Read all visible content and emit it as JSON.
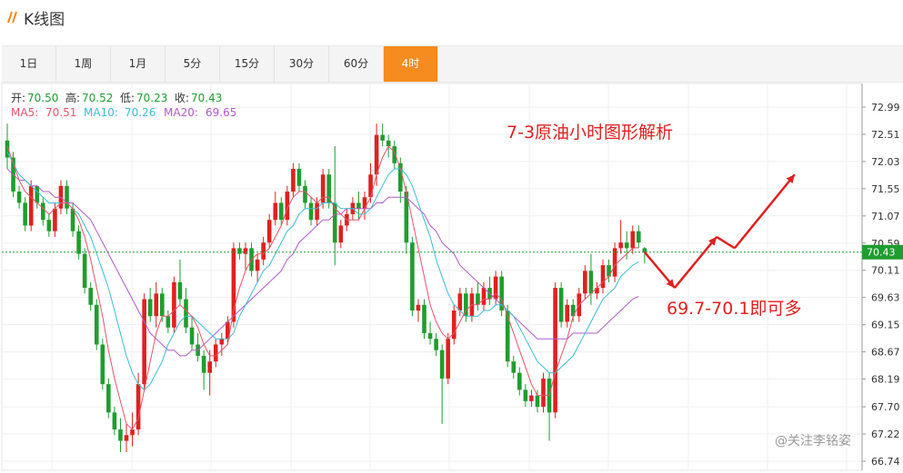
{
  "app": {
    "title": "K线图"
  },
  "tabs": [
    {
      "label": "1日",
      "active": false
    },
    {
      "label": "1周",
      "active": false
    },
    {
      "label": "1月",
      "active": false
    },
    {
      "label": "5分",
      "active": false
    },
    {
      "label": "15分",
      "active": false
    },
    {
      "label": "30分",
      "active": false
    },
    {
      "label": "60分",
      "active": false
    },
    {
      "label": "4时",
      "active": true
    }
  ],
  "ohlc": {
    "open_label": "开:",
    "open": "70.50",
    "high_label": "高:",
    "high": "70.52",
    "low_label": "低:",
    "low": "70.23",
    "close_label": "收:",
    "close": "70.43"
  },
  "ma": {
    "ma5_label": "MA5:",
    "ma5": "70.51",
    "ma10_label": "MA10:",
    "ma10": "70.26",
    "ma20_label": "MA20:",
    "ma20": "69.65"
  },
  "annotations": {
    "title": "7-3原油小时图形解析",
    "advice": "69.7-70.1即可多",
    "watermark": "@关注李铭姿"
  },
  "colors": {
    "up": "#e02020",
    "down": "#1f9d2f",
    "ma5": "#e8536a",
    "ma10": "#3bbcd4",
    "ma20": "#b05ac8",
    "accent": "#f68b1f",
    "annotation": "#e02020",
    "last_price_bg": "#1f9d2f"
  },
  "chart_data": {
    "type": "candlestick",
    "y_axis_ticks": [
      "72.99",
      "72.51",
      "72.03",
      "71.55",
      "71.07",
      "70.59",
      "70.11",
      "69.63",
      "69.15",
      "68.67",
      "68.19",
      "67.70",
      "67.22",
      "66.74"
    ],
    "ylim": [
      66.74,
      72.99
    ],
    "last_price": "70.43",
    "grid": true,
    "candles": [
      [
        72.4,
        72.7,
        71.9,
        72.1
      ],
      [
        72.1,
        72.2,
        71.4,
        71.5
      ],
      [
        71.5,
        71.6,
        71.2,
        71.3
      ],
      [
        71.3,
        71.4,
        70.8,
        70.9
      ],
      [
        70.9,
        71.7,
        70.8,
        71.6
      ],
      [
        71.6,
        71.6,
        71.2,
        71.3
      ],
      [
        71.3,
        71.4,
        70.9,
        71.0
      ],
      [
        71.0,
        71.1,
        70.7,
        70.8
      ],
      [
        70.8,
        71.3,
        70.7,
        71.2
      ],
      [
        71.2,
        71.7,
        71.1,
        71.6
      ],
      [
        71.6,
        71.7,
        71.1,
        71.2
      ],
      [
        71.2,
        71.3,
        70.7,
        70.8
      ],
      [
        70.8,
        70.9,
        70.3,
        70.4
      ],
      [
        70.4,
        70.5,
        69.7,
        69.8
      ],
      [
        69.8,
        69.9,
        69.4,
        69.5
      ],
      [
        69.5,
        69.6,
        68.7,
        68.8
      ],
      [
        68.8,
        68.9,
        68.0,
        68.1
      ],
      [
        68.1,
        68.2,
        67.5,
        67.6
      ],
      [
        67.6,
        67.7,
        67.2,
        67.3
      ],
      [
        67.3,
        67.5,
        66.9,
        67.1
      ],
      [
        67.1,
        67.4,
        66.9,
        67.2
      ],
      [
        67.2,
        67.6,
        67.0,
        67.3
      ],
      [
        67.3,
        68.3,
        67.2,
        68.1
      ],
      [
        68.1,
        69.7,
        68.0,
        69.6
      ],
      [
        69.6,
        69.8,
        69.2,
        69.3
      ],
      [
        69.3,
        69.9,
        69.1,
        69.7
      ],
      [
        69.7,
        69.8,
        69.2,
        69.3
      ],
      [
        69.3,
        69.4,
        69.0,
        69.1
      ],
      [
        69.1,
        70.0,
        69.0,
        69.9
      ],
      [
        69.9,
        70.3,
        69.5,
        69.6
      ],
      [
        69.6,
        69.8,
        69.0,
        69.1
      ],
      [
        69.1,
        69.3,
        68.7,
        68.8
      ],
      [
        68.8,
        69.0,
        68.5,
        68.6
      ],
      [
        68.6,
        68.7,
        68.0,
        68.3
      ],
      [
        68.3,
        68.7,
        67.9,
        68.5
      ],
      [
        68.5,
        68.9,
        68.4,
        68.8
      ],
      [
        68.8,
        69.0,
        68.6,
        68.9
      ],
      [
        68.9,
        69.3,
        68.8,
        69.2
      ],
      [
        69.2,
        70.6,
        69.1,
        70.5
      ],
      [
        70.5,
        70.6,
        70.3,
        70.4
      ],
      [
        70.4,
        70.6,
        70.1,
        70.5
      ],
      [
        70.5,
        70.6,
        70.0,
        70.1
      ],
      [
        70.1,
        70.4,
        69.9,
        70.3
      ],
      [
        70.3,
        70.7,
        70.2,
        70.6
      ],
      [
        70.6,
        71.1,
        70.5,
        71.0
      ],
      [
        71.0,
        71.5,
        70.9,
        71.3
      ],
      [
        71.3,
        71.4,
        70.9,
        71.0
      ],
      [
        71.0,
        71.6,
        70.9,
        71.5
      ],
      [
        71.5,
        72.0,
        71.4,
        71.9
      ],
      [
        71.9,
        72.0,
        71.5,
        71.6
      ],
      [
        71.6,
        71.7,
        71.2,
        71.3
      ],
      [
        71.3,
        71.4,
        70.9,
        71.0
      ],
      [
        71.0,
        71.4,
        70.9,
        71.3
      ],
      [
        71.3,
        71.9,
        71.2,
        71.8
      ],
      [
        71.8,
        71.9,
        71.2,
        71.3
      ],
      [
        71.3,
        72.3,
        70.2,
        70.6
      ],
      [
        70.6,
        71.0,
        70.5,
        70.9
      ],
      [
        70.9,
        71.2,
        70.8,
        71.1
      ],
      [
        71.1,
        71.4,
        71.0,
        71.3
      ],
      [
        71.3,
        71.5,
        71.0,
        71.2
      ],
      [
        71.2,
        71.5,
        71.0,
        71.4
      ],
      [
        71.4,
        72.0,
        71.3,
        71.8
      ],
      [
        71.8,
        72.7,
        71.6,
        72.5
      ],
      [
        72.5,
        72.7,
        72.3,
        72.4
      ],
      [
        72.4,
        72.5,
        72.1,
        72.3
      ],
      [
        72.3,
        72.4,
        71.9,
        72.0
      ],
      [
        72.0,
        72.1,
        71.3,
        71.5
      ],
      [
        71.5,
        71.6,
        70.4,
        70.6
      ],
      [
        70.6,
        70.7,
        69.3,
        69.4
      ],
      [
        69.4,
        69.6,
        69.2,
        69.5
      ],
      [
        69.5,
        69.6,
        68.9,
        69.0
      ],
      [
        69.0,
        69.2,
        68.8,
        68.9
      ],
      [
        68.9,
        69.0,
        68.6,
        68.7
      ],
      [
        68.7,
        68.8,
        67.4,
        68.2
      ],
      [
        68.2,
        69.0,
        68.1,
        68.9
      ],
      [
        68.9,
        69.5,
        68.8,
        69.4
      ],
      [
        69.4,
        69.8,
        69.3,
        69.7
      ],
      [
        69.7,
        69.8,
        69.2,
        69.3
      ],
      [
        69.3,
        69.8,
        69.2,
        69.7
      ],
      [
        69.7,
        69.9,
        69.4,
        69.5
      ],
      [
        69.5,
        69.9,
        69.4,
        69.8
      ],
      [
        69.8,
        70.0,
        69.5,
        69.6
      ],
      [
        69.6,
        70.1,
        69.5,
        70.0
      ],
      [
        70.0,
        70.1,
        69.3,
        69.4
      ],
      [
        69.4,
        69.5,
        68.4,
        68.5
      ],
      [
        68.5,
        68.6,
        68.2,
        68.3
      ],
      [
        68.3,
        68.4,
        67.9,
        68.0
      ],
      [
        68.0,
        68.1,
        67.7,
        67.8
      ],
      [
        67.8,
        68.0,
        67.7,
        67.9
      ],
      [
        67.9,
        68.0,
        67.6,
        67.7
      ],
      [
        67.7,
        68.3,
        67.6,
        68.2
      ],
      [
        68.2,
        68.3,
        67.1,
        67.6
      ],
      [
        67.6,
        69.9,
        67.5,
        69.8
      ],
      [
        69.8,
        69.9,
        69.1,
        69.2
      ],
      [
        69.2,
        69.6,
        69.1,
        69.5
      ],
      [
        69.5,
        69.6,
        69.2,
        69.3
      ],
      [
        69.3,
        69.8,
        69.2,
        69.7
      ],
      [
        69.7,
        70.2,
        69.6,
        70.1
      ],
      [
        70.1,
        70.4,
        69.5,
        69.7
      ],
      [
        69.7,
        69.9,
        69.6,
        69.8
      ],
      [
        69.8,
        70.3,
        69.7,
        70.2
      ],
      [
        70.2,
        70.3,
        69.9,
        70.0
      ],
      [
        70.0,
        70.6,
        69.9,
        70.5
      ],
      [
        70.5,
        71.0,
        70.4,
        70.6
      ],
      [
        70.6,
        70.8,
        70.3,
        70.5
      ],
      [
        70.5,
        70.9,
        70.4,
        70.8
      ],
      [
        70.8,
        70.9,
        70.5,
        70.6
      ],
      [
        70.5,
        70.52,
        70.23,
        70.43
      ]
    ],
    "ma5": [
      72.3,
      72.0,
      71.7,
      71.5,
      71.4,
      71.3,
      71.2,
      71.1,
      71.2,
      71.3,
      71.3,
      71.2,
      71.0,
      70.7,
      70.3,
      69.8,
      69.3,
      68.7,
      68.2,
      67.8,
      67.4,
      67.3,
      67.5,
      68.0,
      68.5,
      69.0,
      69.3,
      69.3,
      69.4,
      69.5,
      69.4,
      69.3,
      69.1,
      68.8,
      68.6,
      68.6,
      68.7,
      68.8,
      69.4,
      69.8,
      70.1,
      70.3,
      70.4,
      70.4,
      70.5,
      70.7,
      70.9,
      71.2,
      71.4,
      71.5,
      71.5,
      71.4,
      71.3,
      71.4,
      71.4,
      71.2,
      71.1,
      71.0,
      71.0,
      71.0,
      71.2,
      71.4,
      71.8,
      72.1,
      72.3,
      72.2,
      71.9,
      71.5,
      71.0,
      70.5,
      70.0,
      69.5,
      69.2,
      69.0,
      68.9,
      69.0,
      69.2,
      69.4,
      69.5,
      69.5,
      69.6,
      69.6,
      69.7,
      69.6,
      69.3,
      69.0,
      68.7,
      68.4,
      68.1,
      67.9,
      67.9,
      67.9,
      68.3,
      68.6,
      68.9,
      69.3,
      69.5,
      69.6,
      69.7,
      69.8,
      69.9,
      70.0,
      70.2,
      70.3,
      70.4,
      70.5,
      70.51
    ],
    "ma10": [
      72.2,
      72.0,
      71.8,
      71.7,
      71.6,
      71.5,
      71.4,
      71.3,
      71.3,
      71.3,
      71.3,
      71.2,
      71.1,
      70.9,
      70.7,
      70.4,
      70.1,
      69.8,
      69.4,
      69.0,
      68.6,
      68.3,
      68.1,
      68.0,
      68.1,
      68.3,
      68.5,
      68.8,
      69.0,
      69.2,
      69.3,
      69.3,
      69.2,
      69.1,
      69.0,
      68.9,
      68.9,
      68.9,
      69.0,
      69.3,
      69.5,
      69.7,
      69.9,
      70.1,
      70.2,
      70.4,
      70.6,
      70.8,
      70.9,
      71.1,
      71.2,
      71.2,
      71.2,
      71.3,
      71.3,
      71.3,
      71.2,
      71.2,
      71.2,
      71.1,
      71.1,
      71.2,
      71.4,
      71.6,
      71.8,
      71.9,
      71.9,
      71.8,
      71.6,
      71.3,
      71.0,
      70.7,
      70.3,
      70.0,
      69.7,
      69.5,
      69.4,
      69.3,
      69.3,
      69.3,
      69.4,
      69.4,
      69.5,
      69.5,
      69.4,
      69.3,
      69.1,
      68.9,
      68.7,
      68.5,
      68.4,
      68.3,
      68.3,
      68.4,
      68.5,
      68.6,
      68.8,
      69.0,
      69.2,
      69.4,
      69.6,
      69.7,
      69.8,
      70.0,
      70.1,
      70.2,
      70.26
    ],
    "ma20": [
      71.9,
      71.8,
      71.7,
      71.7,
      71.6,
      71.6,
      71.5,
      71.5,
      71.4,
      71.4,
      71.3,
      71.3,
      71.2,
      71.1,
      71.0,
      70.8,
      70.6,
      70.4,
      70.2,
      70.0,
      69.8,
      69.6,
      69.4,
      69.2,
      69.0,
      68.9,
      68.8,
      68.7,
      68.7,
      68.6,
      68.6,
      68.7,
      68.7,
      68.8,
      68.9,
      69.0,
      69.1,
      69.2,
      69.3,
      69.4,
      69.5,
      69.6,
      69.7,
      69.8,
      69.9,
      70.0,
      70.1,
      70.3,
      70.4,
      70.6,
      70.7,
      70.8,
      70.9,
      71.0,
      71.0,
      71.1,
      71.1,
      71.2,
      71.2,
      71.2,
      71.2,
      71.2,
      71.3,
      71.3,
      71.4,
      71.4,
      71.4,
      71.4,
      71.3,
      71.2,
      71.1,
      70.9,
      70.8,
      70.6,
      70.5,
      70.4,
      70.2,
      70.1,
      70.0,
      69.9,
      69.8,
      69.7,
      69.6,
      69.5,
      69.4,
      69.3,
      69.2,
      69.1,
      69.0,
      68.9,
      68.9,
      68.9,
      68.9,
      68.9,
      68.9,
      69.0,
      69.0,
      69.0,
      69.0,
      69.0,
      69.1,
      69.2,
      69.3,
      69.4,
      69.5,
      69.6,
      69.65
    ],
    "projection": [
      [
        70.43,
        0
      ],
      [
        69.8,
        5
      ],
      [
        70.7,
        12
      ],
      [
        70.5,
        15
      ],
      [
        71.8,
        25
      ]
    ]
  }
}
